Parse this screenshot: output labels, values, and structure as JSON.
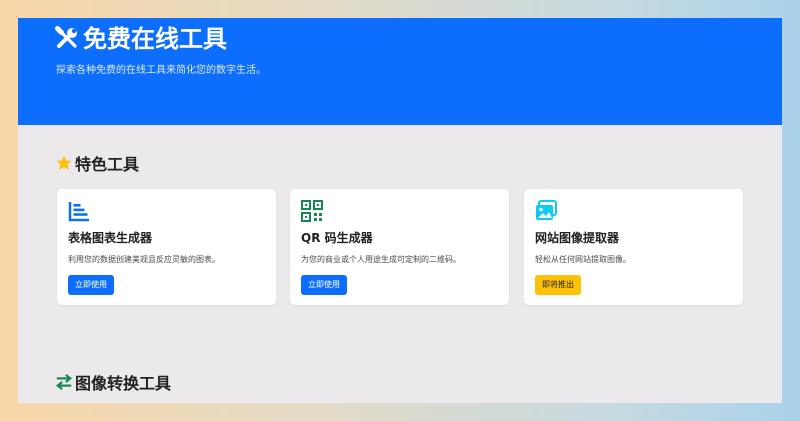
{
  "colors": {
    "primary": "#0d6efd",
    "warning": "#ffc107",
    "success": "#198754",
    "info": "#0dcaf0"
  },
  "hero": {
    "title": "免费在线工具",
    "subtitle": "探索各种免费的在线工具来简化您的数字生活。",
    "icon": "tools-icon"
  },
  "featured": {
    "title": "特色工具",
    "icon": "star-icon",
    "cards": [
      {
        "icon": "bar-chart-icon",
        "title": "表格图表生成器",
        "description": "利用您的数据创建美观且反应灵敏的图表。",
        "button": "立即使用",
        "button_style": "primary"
      },
      {
        "icon": "qr-code-icon",
        "title": "QR 码生成器",
        "description": "为您的商业或个人用途生成可定制的二维码。",
        "button": "立即使用",
        "button_style": "primary"
      },
      {
        "icon": "images-icon",
        "title": "网站图像提取器",
        "description": "轻松从任何网站提取图像。",
        "button": "即将推出",
        "button_style": "warning"
      }
    ]
  },
  "convert": {
    "title": "图像转换工具",
    "icon": "arrows-exchange-icon"
  }
}
